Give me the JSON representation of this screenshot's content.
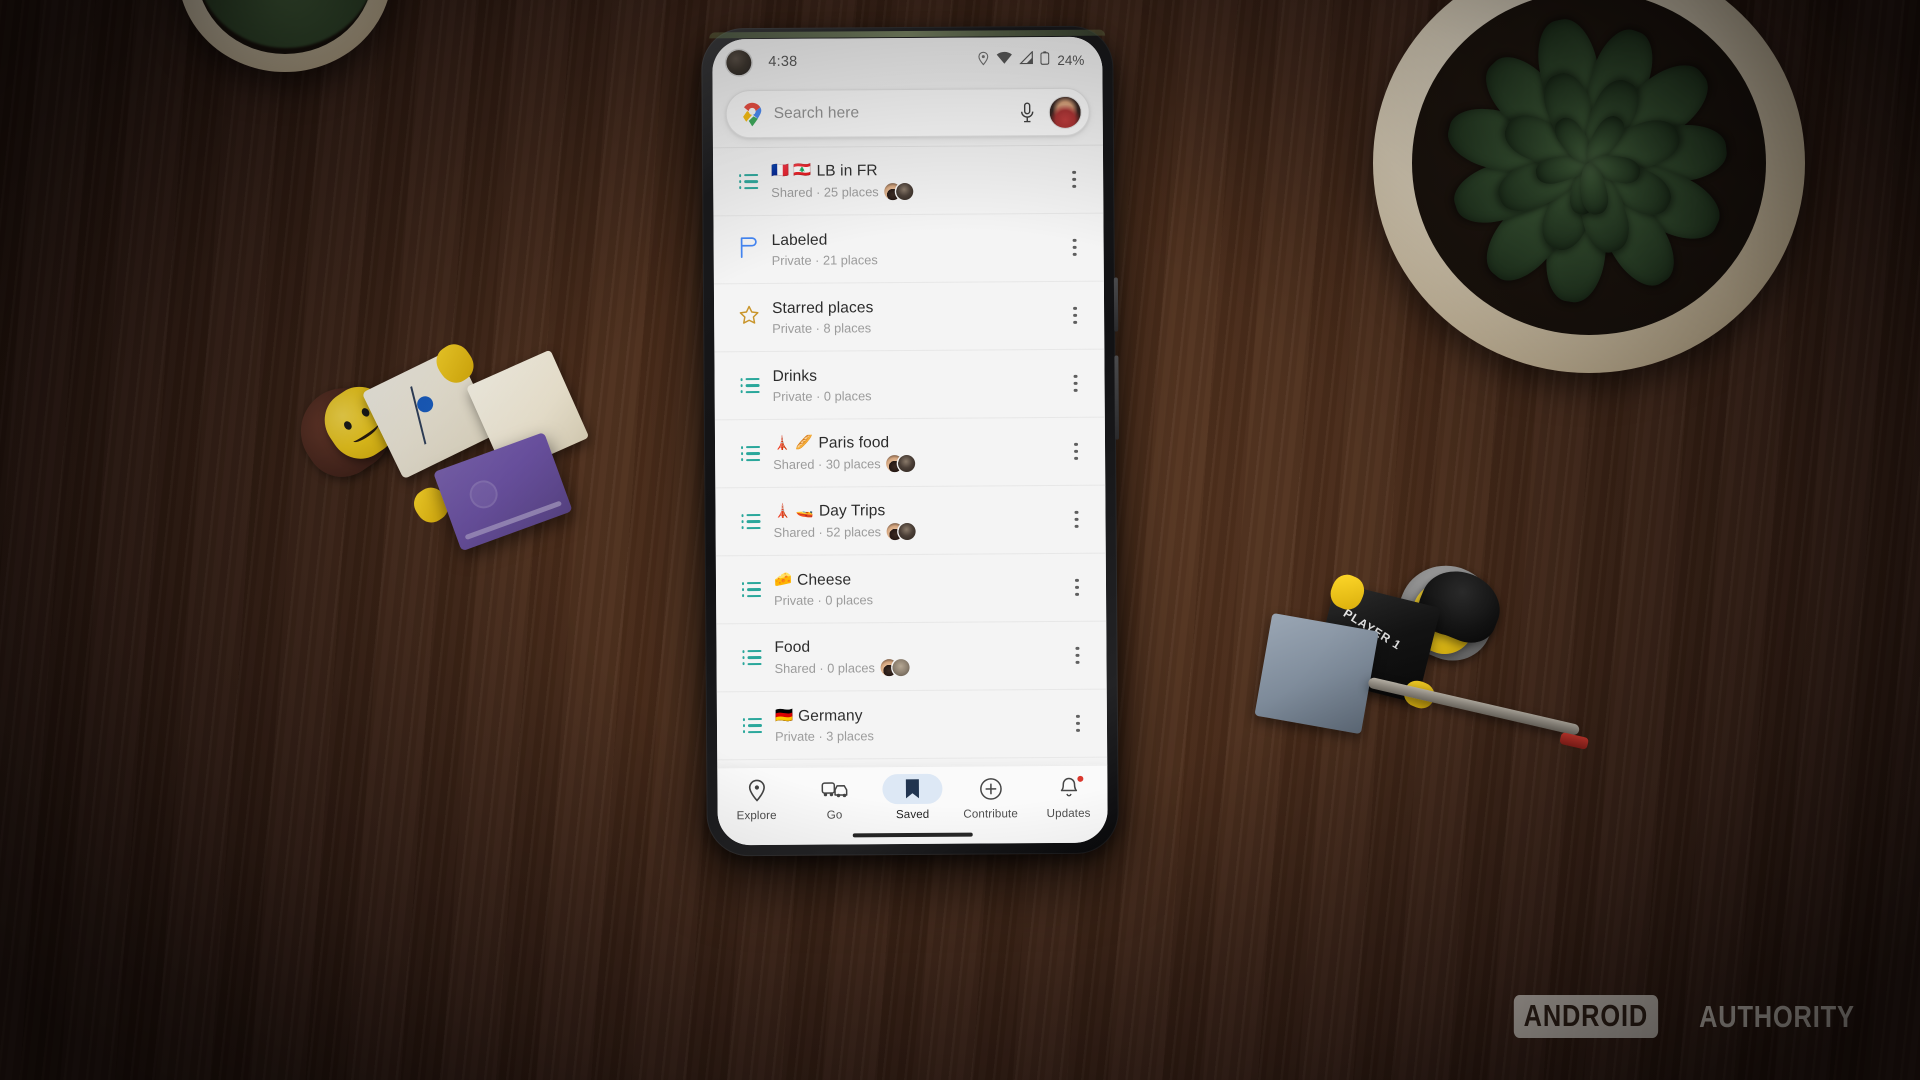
{
  "scene": {
    "surface": "dark-walnut-wood-desk",
    "watermark": {
      "brand": "ANDROID",
      "suffix": "AUTHORITY"
    },
    "props": [
      {
        "name": "succulent-plant",
        "pot_color": "#e3d7c0"
      },
      {
        "name": "lego-doctor-minifigure",
        "shirt": "white-lab-coat",
        "brick_color": "#6a51a0"
      },
      {
        "name": "lego-gamer-minifigure",
        "shirt_text": "PLAYER 1",
        "accessory": "stylus-pen"
      }
    ]
  },
  "phone": {
    "statusbar": {
      "clock": "4:38",
      "battery": "24%",
      "icons": [
        "location-icon",
        "wifi-icon",
        "signal-icon",
        "battery-icon"
      ]
    },
    "search": {
      "placeholder": "Search here",
      "maps_pin_icon": "google-maps-pin-icon",
      "mic_icon": "microphone-icon",
      "avatar": "account-avatar"
    },
    "saved_lists": [
      {
        "emoji": "🇫🇷 🇱🇧",
        "emoji_name": "flag-france flag-lebanon",
        "title": "LB in FR",
        "subtitle": "Shared · 25 places",
        "privacy": "Shared",
        "places": 25,
        "icon": "list-icon",
        "icon_color": "#2aa79b",
        "faces": [
          "f1",
          "f2"
        ]
      },
      {
        "emoji": "",
        "emoji_name": "",
        "title": "Labeled",
        "subtitle": "Private · 21 places",
        "privacy": "Private",
        "places": 21,
        "icon": "label-flag-icon",
        "icon_color": "#4285f4",
        "faces": []
      },
      {
        "emoji": "",
        "emoji_name": "",
        "title": "Starred places",
        "subtitle": "Private · 8 places",
        "privacy": "Private",
        "places": 8,
        "icon": "star-outline-icon",
        "icon_color": "#c9952b",
        "faces": []
      },
      {
        "emoji": "",
        "emoji_name": "",
        "title": "Drinks",
        "subtitle": "Private · 0 places",
        "privacy": "Private",
        "places": 0,
        "icon": "list-icon",
        "icon_color": "#2aa79b",
        "faces": []
      },
      {
        "emoji": "🗼 🥖",
        "emoji_name": "eiffel-tower baguette",
        "title": "Paris food",
        "subtitle": "Shared · 30 places",
        "privacy": "Shared",
        "places": 30,
        "icon": "list-icon",
        "icon_color": "#2aa79b",
        "faces": [
          "f1",
          "f2"
        ]
      },
      {
        "emoji": "🗼 🚤",
        "emoji_name": "eiffel-tower speedboat",
        "title": "Day Trips",
        "subtitle": "Shared · 52 places",
        "privacy": "Shared",
        "places": 52,
        "icon": "list-icon",
        "icon_color": "#2aa79b",
        "faces": [
          "f1",
          "f2"
        ]
      },
      {
        "emoji": "🧀",
        "emoji_name": "cheese-wedge",
        "title": "Cheese",
        "subtitle": "Private · 0 places",
        "privacy": "Private",
        "places": 0,
        "icon": "list-icon",
        "icon_color": "#2aa79b",
        "faces": []
      },
      {
        "emoji": "",
        "emoji_name": "",
        "title": "Food",
        "subtitle": "Shared · 0 places",
        "privacy": "Shared",
        "places": 0,
        "icon": "list-icon",
        "icon_color": "#2aa79b",
        "faces": [
          "f1",
          "f3"
        ]
      },
      {
        "emoji": "🇩🇪",
        "emoji_name": "flag-germany",
        "title": "Germany",
        "subtitle": "Private · 3 places",
        "privacy": "Private",
        "places": 3,
        "icon": "list-icon",
        "icon_color": "#2aa79b",
        "faces": []
      }
    ],
    "bottom_nav": [
      {
        "label": "Explore",
        "icon": "map-pin-icon",
        "active": false,
        "badge": false
      },
      {
        "label": "Go",
        "icon": "commute-icon",
        "active": false,
        "badge": false
      },
      {
        "label": "Saved",
        "icon": "bookmark-icon",
        "active": true,
        "badge": false
      },
      {
        "label": "Contribute",
        "icon": "plus-circle-icon",
        "active": false,
        "badge": false
      },
      {
        "label": "Updates",
        "icon": "bell-icon",
        "active": false,
        "badge": true
      }
    ]
  },
  "colors": {
    "accent_teal": "#2aa79b",
    "accent_blue": "#4285f4",
    "star_gold": "#c9952b",
    "active_pill": "#dce7f5",
    "badge_red": "#d93025",
    "screen_bg": "#f4f4f4"
  }
}
